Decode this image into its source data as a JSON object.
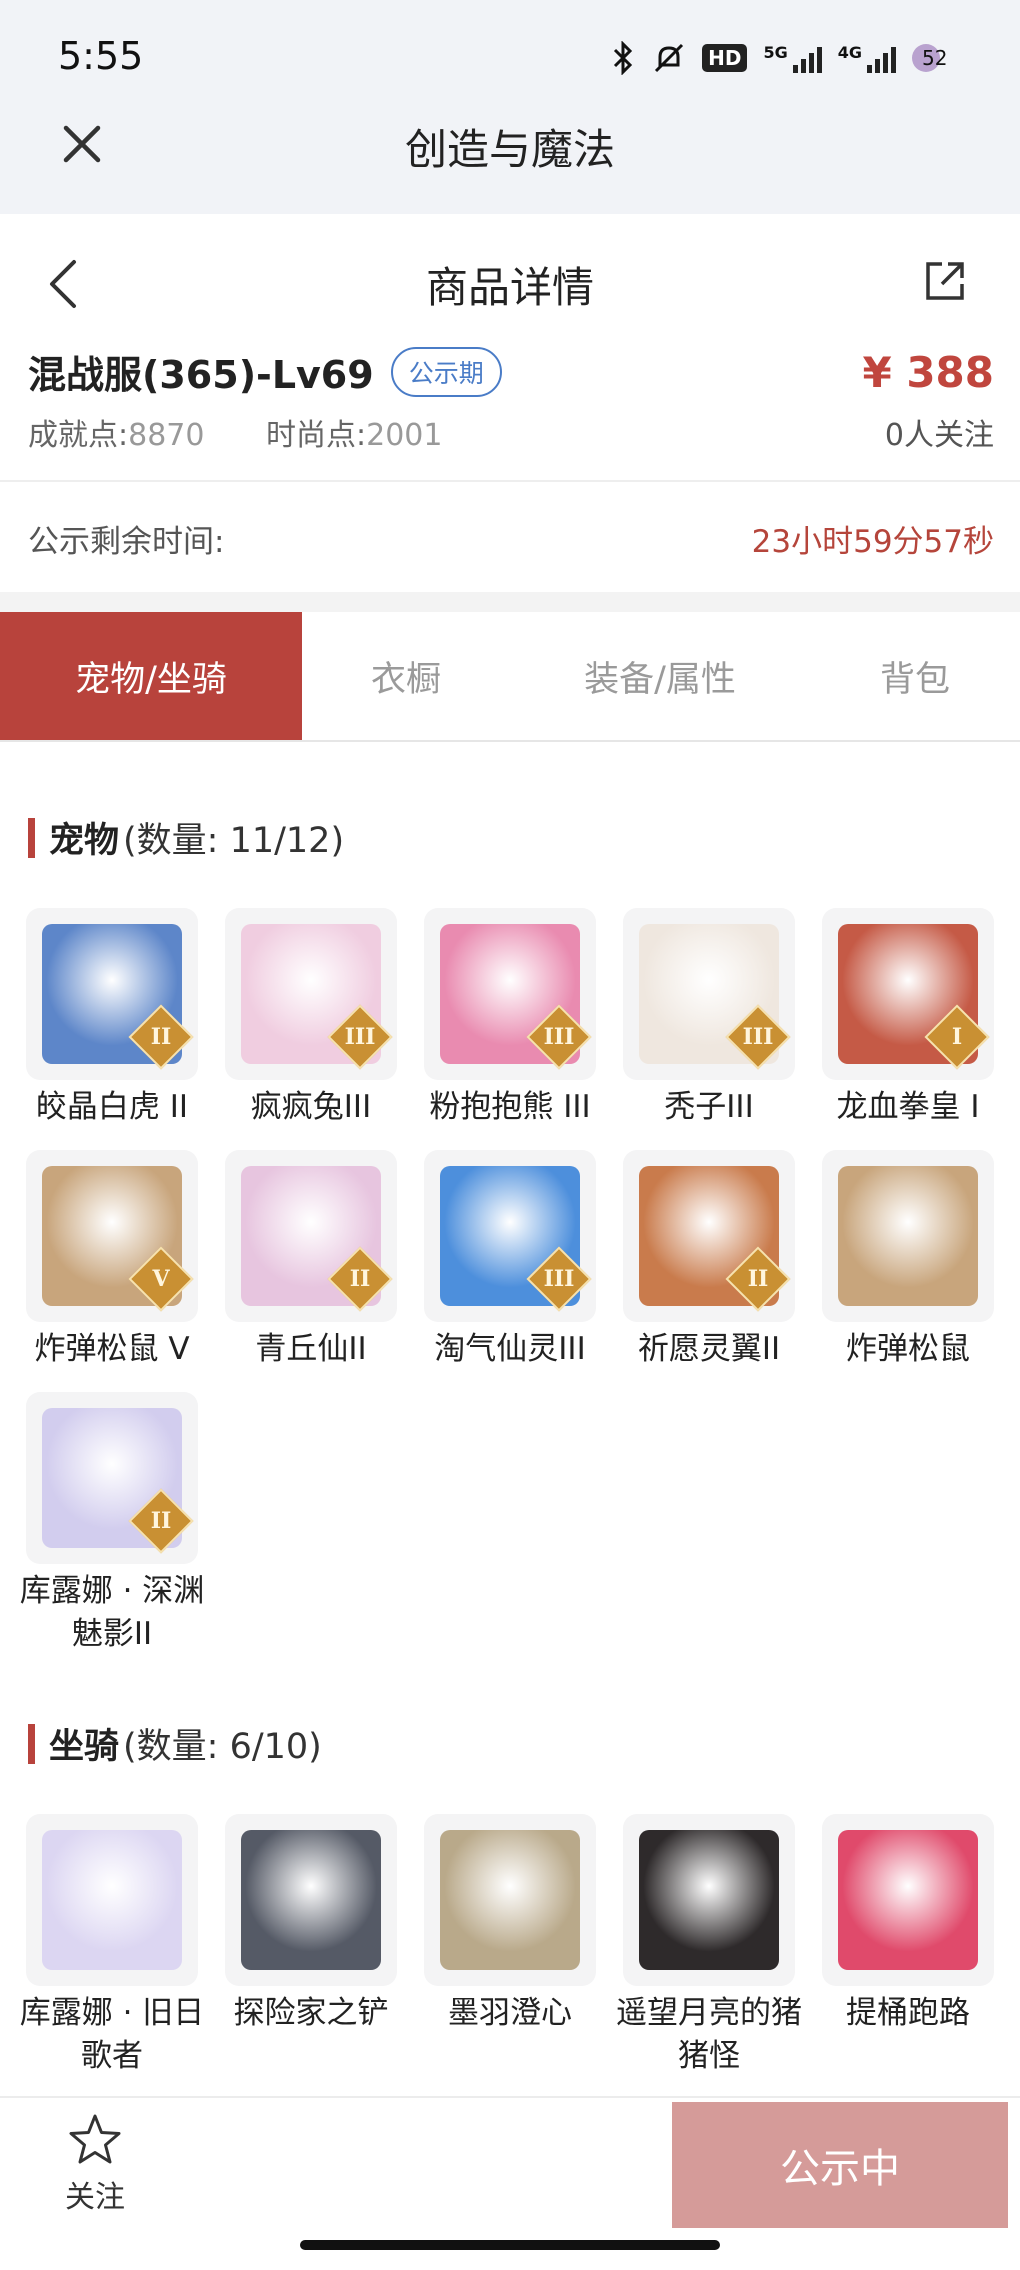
{
  "status_bar": {
    "time": "5:55",
    "hd": "HD",
    "net1": "5G",
    "net2": "4G",
    "battery": "52"
  },
  "app": {
    "title": "创造与魔法"
  },
  "page": {
    "title": "商品详情"
  },
  "product": {
    "name": "混战服(365)-Lv69",
    "badge": "公示期",
    "price": "¥ 388",
    "achievement_label": "成就点:",
    "achievement_value": "8870",
    "fashion_label": "时尚点:",
    "fashion_value": "2001",
    "followers": "0人关注"
  },
  "countdown": {
    "label": "公示剩余时间:",
    "value": "23小时59分57秒"
  },
  "tabs": [
    {
      "label": "宠物/坐骑",
      "active": true
    },
    {
      "label": "衣橱",
      "active": false
    },
    {
      "label": "装备/属性",
      "active": false
    },
    {
      "label": "背包",
      "active": false
    }
  ],
  "pets": {
    "title": "宠物",
    "count": "(数量: 11/12)",
    "items": [
      {
        "name": "皎晶白虎 II",
        "grade": "II",
        "color": "#5d86c9"
      },
      {
        "name": "疯疯兔III",
        "grade": "III",
        "color": "#f0cde0"
      },
      {
        "name": "粉抱抱熊 III",
        "grade": "III",
        "color": "#e98bb0"
      },
      {
        "name": "秃子III",
        "grade": "III",
        "color": "#efe7df"
      },
      {
        "name": "龙血拳皇 I",
        "grade": "I",
        "color": "#c55a46"
      },
      {
        "name": "炸弹松鼠 V",
        "grade": "V",
        "color": "#c8a57c"
      },
      {
        "name": "青丘仙II",
        "grade": "II",
        "color": "#e7c5df"
      },
      {
        "name": "淘气仙灵III",
        "grade": "III",
        "color": "#4d8fdc"
      },
      {
        "name": "祈愿灵翼II",
        "grade": "II",
        "color": "#c97b4c"
      },
      {
        "name": "炸弹松鼠",
        "grade": "",
        "color": "#c8a57c"
      },
      {
        "name": "库露娜 · 深渊魅影II",
        "grade": "II",
        "color": "#d2cdee"
      }
    ]
  },
  "mounts": {
    "title": "坐骑",
    "count": "(数量: 6/10)",
    "items": [
      {
        "name": "库露娜 · 旧日歌者",
        "grade": "",
        "color": "#dcd6f2"
      },
      {
        "name": "探险家之铲",
        "grade": "",
        "color": "#555a66"
      },
      {
        "name": "墨羽澄心",
        "grade": "",
        "color": "#b9a98a"
      },
      {
        "name": "遥望月亮的猪猪怪",
        "grade": "",
        "color": "#2e2a2b"
      },
      {
        "name": "提桶跑路",
        "grade": "",
        "color": "#e04a6b"
      }
    ]
  },
  "bottom": {
    "follow": "关注",
    "action": "公示中"
  }
}
